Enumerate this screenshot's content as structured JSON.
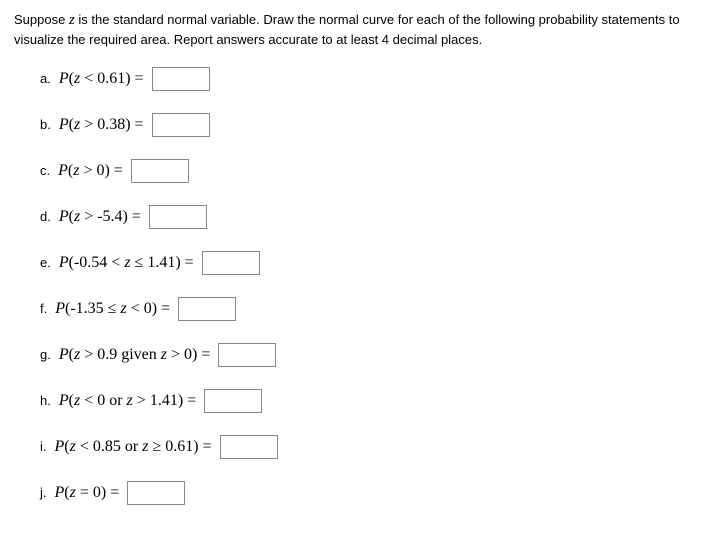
{
  "intro": {
    "pre": "Suppose ",
    "var": "z",
    "post": " is the standard normal variable. Draw the normal curve for each of the following probability statements to visualize the required area. Report answers accurate to at least 4 decimal places."
  },
  "q": {
    "a": {
      "label": "a.",
      "lhs": "P",
      "open": "(",
      "sub": "z",
      "rel": " < ",
      "v1": "0.61",
      "close": ")",
      "eq": " = "
    },
    "b": {
      "label": "b.",
      "lhs": "P",
      "open": "(",
      "sub": "z",
      "rel": " > ",
      "v1": "0.38",
      "close": ")",
      "eq": " = "
    },
    "c": {
      "label": "c.",
      "lhs": "P",
      "open": "(",
      "sub": "z",
      "rel": " > ",
      "v1": "0",
      "close": ")",
      "eq": " = "
    },
    "d": {
      "label": "d.",
      "lhs": "P",
      "open": "(",
      "sub": "z",
      "rel": " > ",
      "v1": "-5.4",
      "close": ")",
      "eq": " = "
    },
    "e": {
      "label": "e.",
      "lhs": "P",
      "open": "(",
      "v1": "-0.54",
      "rel1": " < ",
      "sub": "z",
      "rel2": " ≤ ",
      "v2": "1.41",
      "close": ")",
      "eq": " = "
    },
    "f": {
      "label": "f.",
      "lhs": "P",
      "open": "(",
      "v1": "-1.35",
      "rel1": " ≤ ",
      "sub": "z",
      "rel2": " < ",
      "v2": "0",
      "close": ")",
      "eq": " = "
    },
    "g": {
      "label": "g.",
      "lhs": "P",
      "open": "(",
      "sub": "z",
      "rel": " > ",
      "v1": "0.9",
      "kw": "  given  ",
      "sub2": "z",
      "rel2": " > ",
      "v2": "0",
      "close": ")",
      "eq": " = "
    },
    "h": {
      "label": "h.",
      "lhs": "P",
      "open": "(",
      "sub": "z",
      "rel": " < ",
      "v1": "0",
      "kw": "  or  ",
      "sub2": "z",
      "rel2": " > ",
      "v2": "1.41",
      "close": ")",
      "eq": " = "
    },
    "i": {
      "label": "i.",
      "lhs": "P",
      "open": "(",
      "sub": "z",
      "rel": " < ",
      "v1": "0.85",
      "kw": "  or  ",
      "sub2": "z",
      "rel2": " ≥ ",
      "v2": "0.61",
      "close": ")",
      "eq": " = "
    },
    "j": {
      "label": "j.",
      "lhs": "P",
      "open": "(",
      "sub": "z",
      "rel": " = ",
      "v1": "0",
      "close": ")",
      "eq": " = "
    }
  }
}
